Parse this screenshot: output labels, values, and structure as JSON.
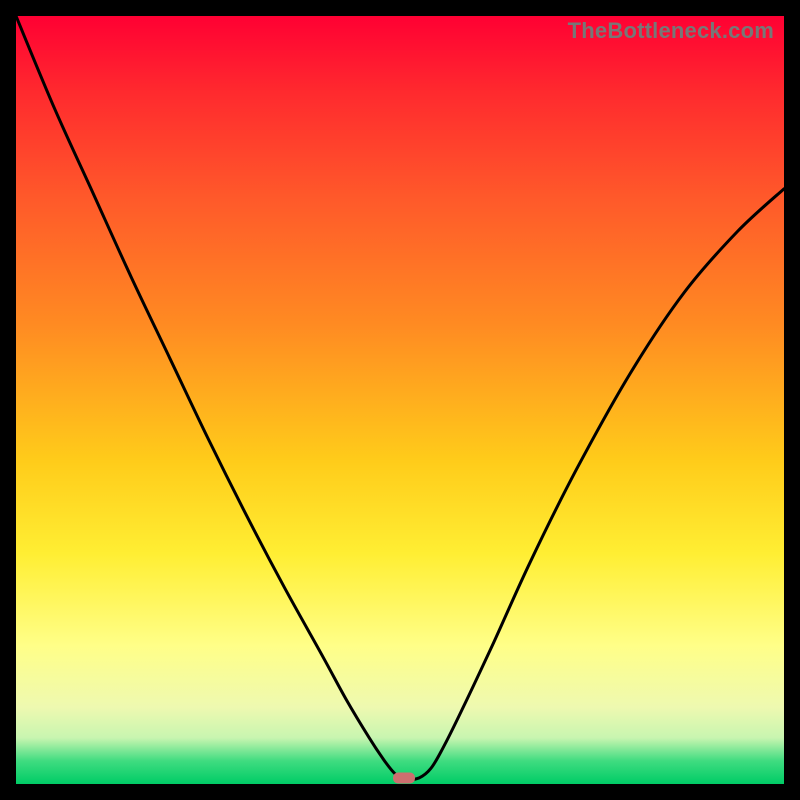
{
  "watermark": "TheBottleneck.com",
  "marker": {
    "x_frac": 0.505,
    "y_frac": 0.992
  },
  "chart_data": {
    "type": "line",
    "title": "",
    "xlabel": "",
    "ylabel": "",
    "xlim": [
      0,
      1
    ],
    "ylim": [
      0,
      1
    ],
    "series": [
      {
        "name": "curve",
        "x": [
          0.0,
          0.05,
          0.1,
          0.15,
          0.2,
          0.25,
          0.3,
          0.35,
          0.4,
          0.43,
          0.46,
          0.48,
          0.495,
          0.51,
          0.525,
          0.54,
          0.555,
          0.58,
          0.62,
          0.67,
          0.73,
          0.8,
          0.87,
          0.94,
          1.0
        ],
        "y": [
          1.0,
          0.88,
          0.77,
          0.66,
          0.555,
          0.45,
          0.35,
          0.255,
          0.165,
          0.11,
          0.06,
          0.03,
          0.012,
          0.006,
          0.008,
          0.02,
          0.045,
          0.095,
          0.18,
          0.29,
          0.41,
          0.535,
          0.64,
          0.72,
          0.775
        ]
      }
    ],
    "gradient_stops": [
      {
        "pos": 0.0,
        "color": "#ff0033"
      },
      {
        "pos": 0.1,
        "color": "#ff2a2e"
      },
      {
        "pos": 0.24,
        "color": "#ff5a2a"
      },
      {
        "pos": 0.4,
        "color": "#ff8a22"
      },
      {
        "pos": 0.58,
        "color": "#ffcc1a"
      },
      {
        "pos": 0.7,
        "color": "#ffee33"
      },
      {
        "pos": 0.82,
        "color": "#ffff88"
      },
      {
        "pos": 0.9,
        "color": "#eef9b0"
      },
      {
        "pos": 0.94,
        "color": "#c8f5b0"
      },
      {
        "pos": 0.97,
        "color": "#3fdc80"
      },
      {
        "pos": 1.0,
        "color": "#00cc66"
      }
    ]
  }
}
